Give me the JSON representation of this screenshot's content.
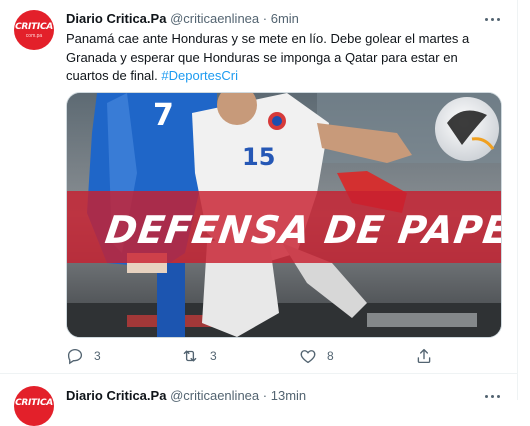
{
  "tweets": [
    {
      "avatar_text": "CRITICA",
      "avatar_sub": "com.pa",
      "name": "Diario Critica.Pa",
      "handle": "@criticaenlinea",
      "separator": "·",
      "time": "6min",
      "text_main": "Panamá cae ante Honduras y se mete en lío. Debe golear el martes a Granada y esperar que Honduras se imponga a Qatar para estar en cuartos de final.",
      "hashtag": "#DeportesCri",
      "media_overlay_text": "DEFENSA DE PAPEL",
      "player_numbers": [
        "7",
        "15"
      ],
      "reply_count": "3",
      "retweet_count": "3",
      "like_count": "8"
    },
    {
      "avatar_text": "CRITICA",
      "name": "Diario Critica.Pa",
      "handle": "@criticaenlinea",
      "separator": "·",
      "time": "13min"
    }
  ],
  "icons": {
    "more": "more-horizontal-icon",
    "reply": "reply-bubble-icon",
    "retweet": "retweet-icon",
    "like": "heart-icon",
    "share": "share-upload-icon"
  },
  "colors": {
    "brand_red": "#e3202a",
    "link_blue": "#1d9bf0",
    "secondary_text": "#536471",
    "banner_red": "#c8202f"
  }
}
